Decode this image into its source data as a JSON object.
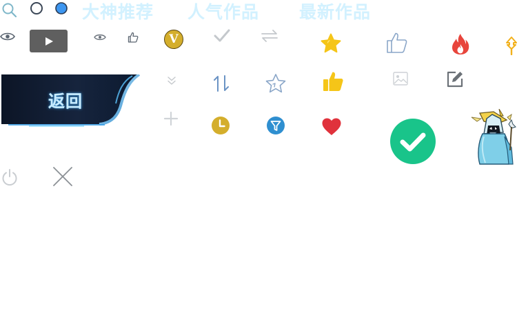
{
  "tabs": [
    {
      "label": "大神推荐"
    },
    {
      "label": "人气作品"
    },
    {
      "label": "最新作品"
    }
  ],
  "back_button": {
    "label": "返回"
  },
  "vip_badge": {
    "label": "V"
  },
  "colors": {
    "tab_text": "#d2f1ff",
    "gold": "#d4ae2c",
    "star_yellow": "#f5c518",
    "success_green": "#19c48a",
    "heart_red": "#e0323c",
    "flame_red": "#e8453c",
    "filter_blue": "#2f8fd0",
    "thumb_outline_blue": "#8aa6c8"
  },
  "icons": [
    "search-icon",
    "radio-empty-icon",
    "radio-filled-icon",
    "eye-icon",
    "play-icon",
    "eye-small-icon",
    "thumb-up-outline-icon",
    "vip-badge-icon",
    "check-icon",
    "swap-icon",
    "star-filled-icon",
    "thumb-up-large-outline-icon",
    "flame-icon",
    "arrow-up-icon",
    "double-chevron-down-icon",
    "sort-icon",
    "star-outline-icon",
    "thumb-up-filled-icon",
    "image-icon",
    "edit-icon",
    "plus-icon",
    "clock-icon",
    "filter-icon",
    "heart-icon",
    "success-check-icon",
    "wizard-mascot-icon",
    "power-icon",
    "close-icon"
  ]
}
